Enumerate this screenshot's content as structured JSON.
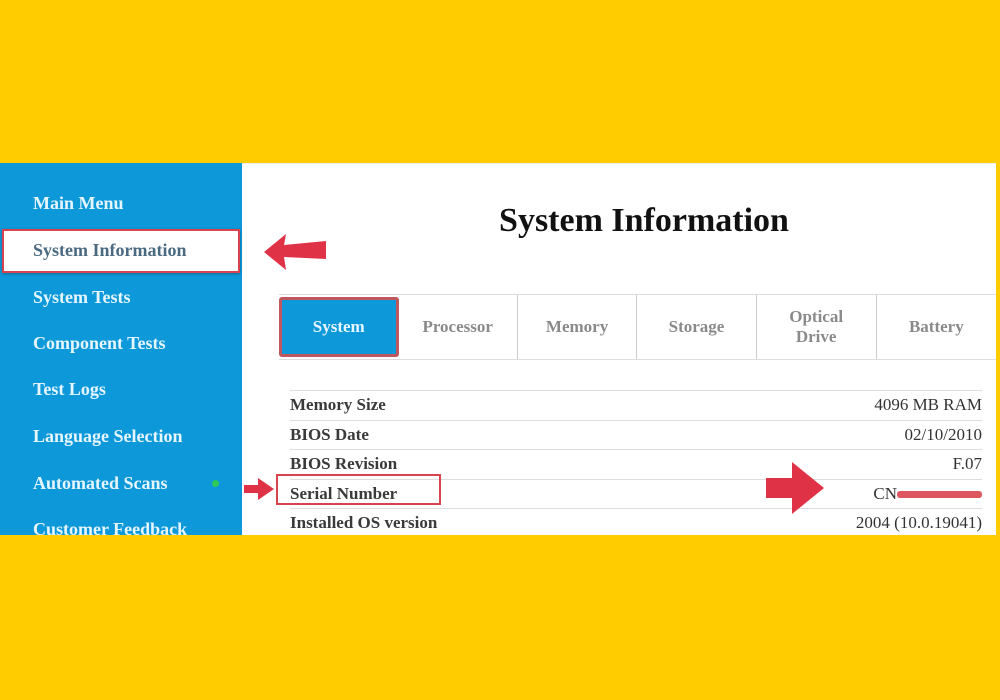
{
  "sidebar": {
    "items": [
      {
        "label": "Main Menu"
      },
      {
        "label": "System Information",
        "active": true
      },
      {
        "label": "System Tests"
      },
      {
        "label": "Component Tests"
      },
      {
        "label": "Test Logs"
      },
      {
        "label": "Language Selection"
      },
      {
        "label": "Automated Scans",
        "status_dot": "green"
      },
      {
        "label": "Customer Feedback"
      }
    ]
  },
  "main": {
    "title": "System Information",
    "tabs": [
      {
        "label": "System",
        "active": true
      },
      {
        "label": "Processor"
      },
      {
        "label": "Memory"
      },
      {
        "label": "Storage"
      },
      {
        "label": "Optical Drive"
      },
      {
        "label": "Battery"
      }
    ],
    "rows": [
      {
        "label": "Memory Size",
        "value": "4096 MB RAM"
      },
      {
        "label": "BIOS Date",
        "value": "02/10/2010"
      },
      {
        "label": "BIOS Revision",
        "value": "F.07"
      },
      {
        "label": "Serial Number",
        "value": "CN",
        "redacted": true
      },
      {
        "label": "Installed OS version",
        "value": "2004 (10.0.19041)"
      }
    ]
  },
  "annotations": {
    "color": "#D8434E",
    "background": "#FFCC00",
    "accent": "#0D98DA"
  }
}
